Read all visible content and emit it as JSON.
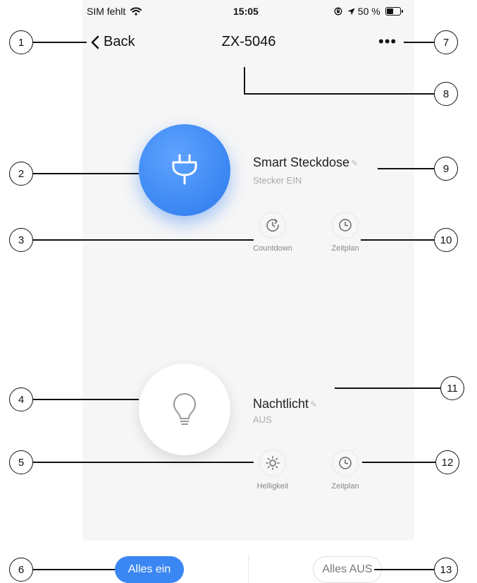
{
  "status_bar": {
    "carrier": "SIM fehlt",
    "time": "15:05",
    "battery": "50 %"
  },
  "nav": {
    "back_label": "Back",
    "title": "ZX-5046",
    "more_label": "•••"
  },
  "devices": [
    {
      "name": "Smart Steckdose",
      "status": "Stecker EIN",
      "icon": "plug-icon",
      "state": "on",
      "actions": [
        {
          "label": "Countdown",
          "icon": "countdown-icon"
        },
        {
          "label": "Zeitplan",
          "icon": "clock-icon"
        }
      ]
    },
    {
      "name": "Nachtlicht",
      "status": "AUS",
      "icon": "lightbulb-icon",
      "state": "off",
      "actions": [
        {
          "label": "Helligkeit",
          "icon": "brightness-icon"
        },
        {
          "label": "Zeitplan",
          "icon": "clock-icon"
        }
      ]
    }
  ],
  "footer": {
    "all_on_label": "Alles ein",
    "all_off_label": "Alles AUS"
  },
  "callouts": [
    "1",
    "2",
    "3",
    "4",
    "5",
    "6",
    "7",
    "8",
    "9",
    "10",
    "11",
    "12",
    "13"
  ],
  "colors": {
    "accent": "#3a86f2",
    "background": "#f6f6f6",
    "muted_text": "#aaaaaa"
  }
}
